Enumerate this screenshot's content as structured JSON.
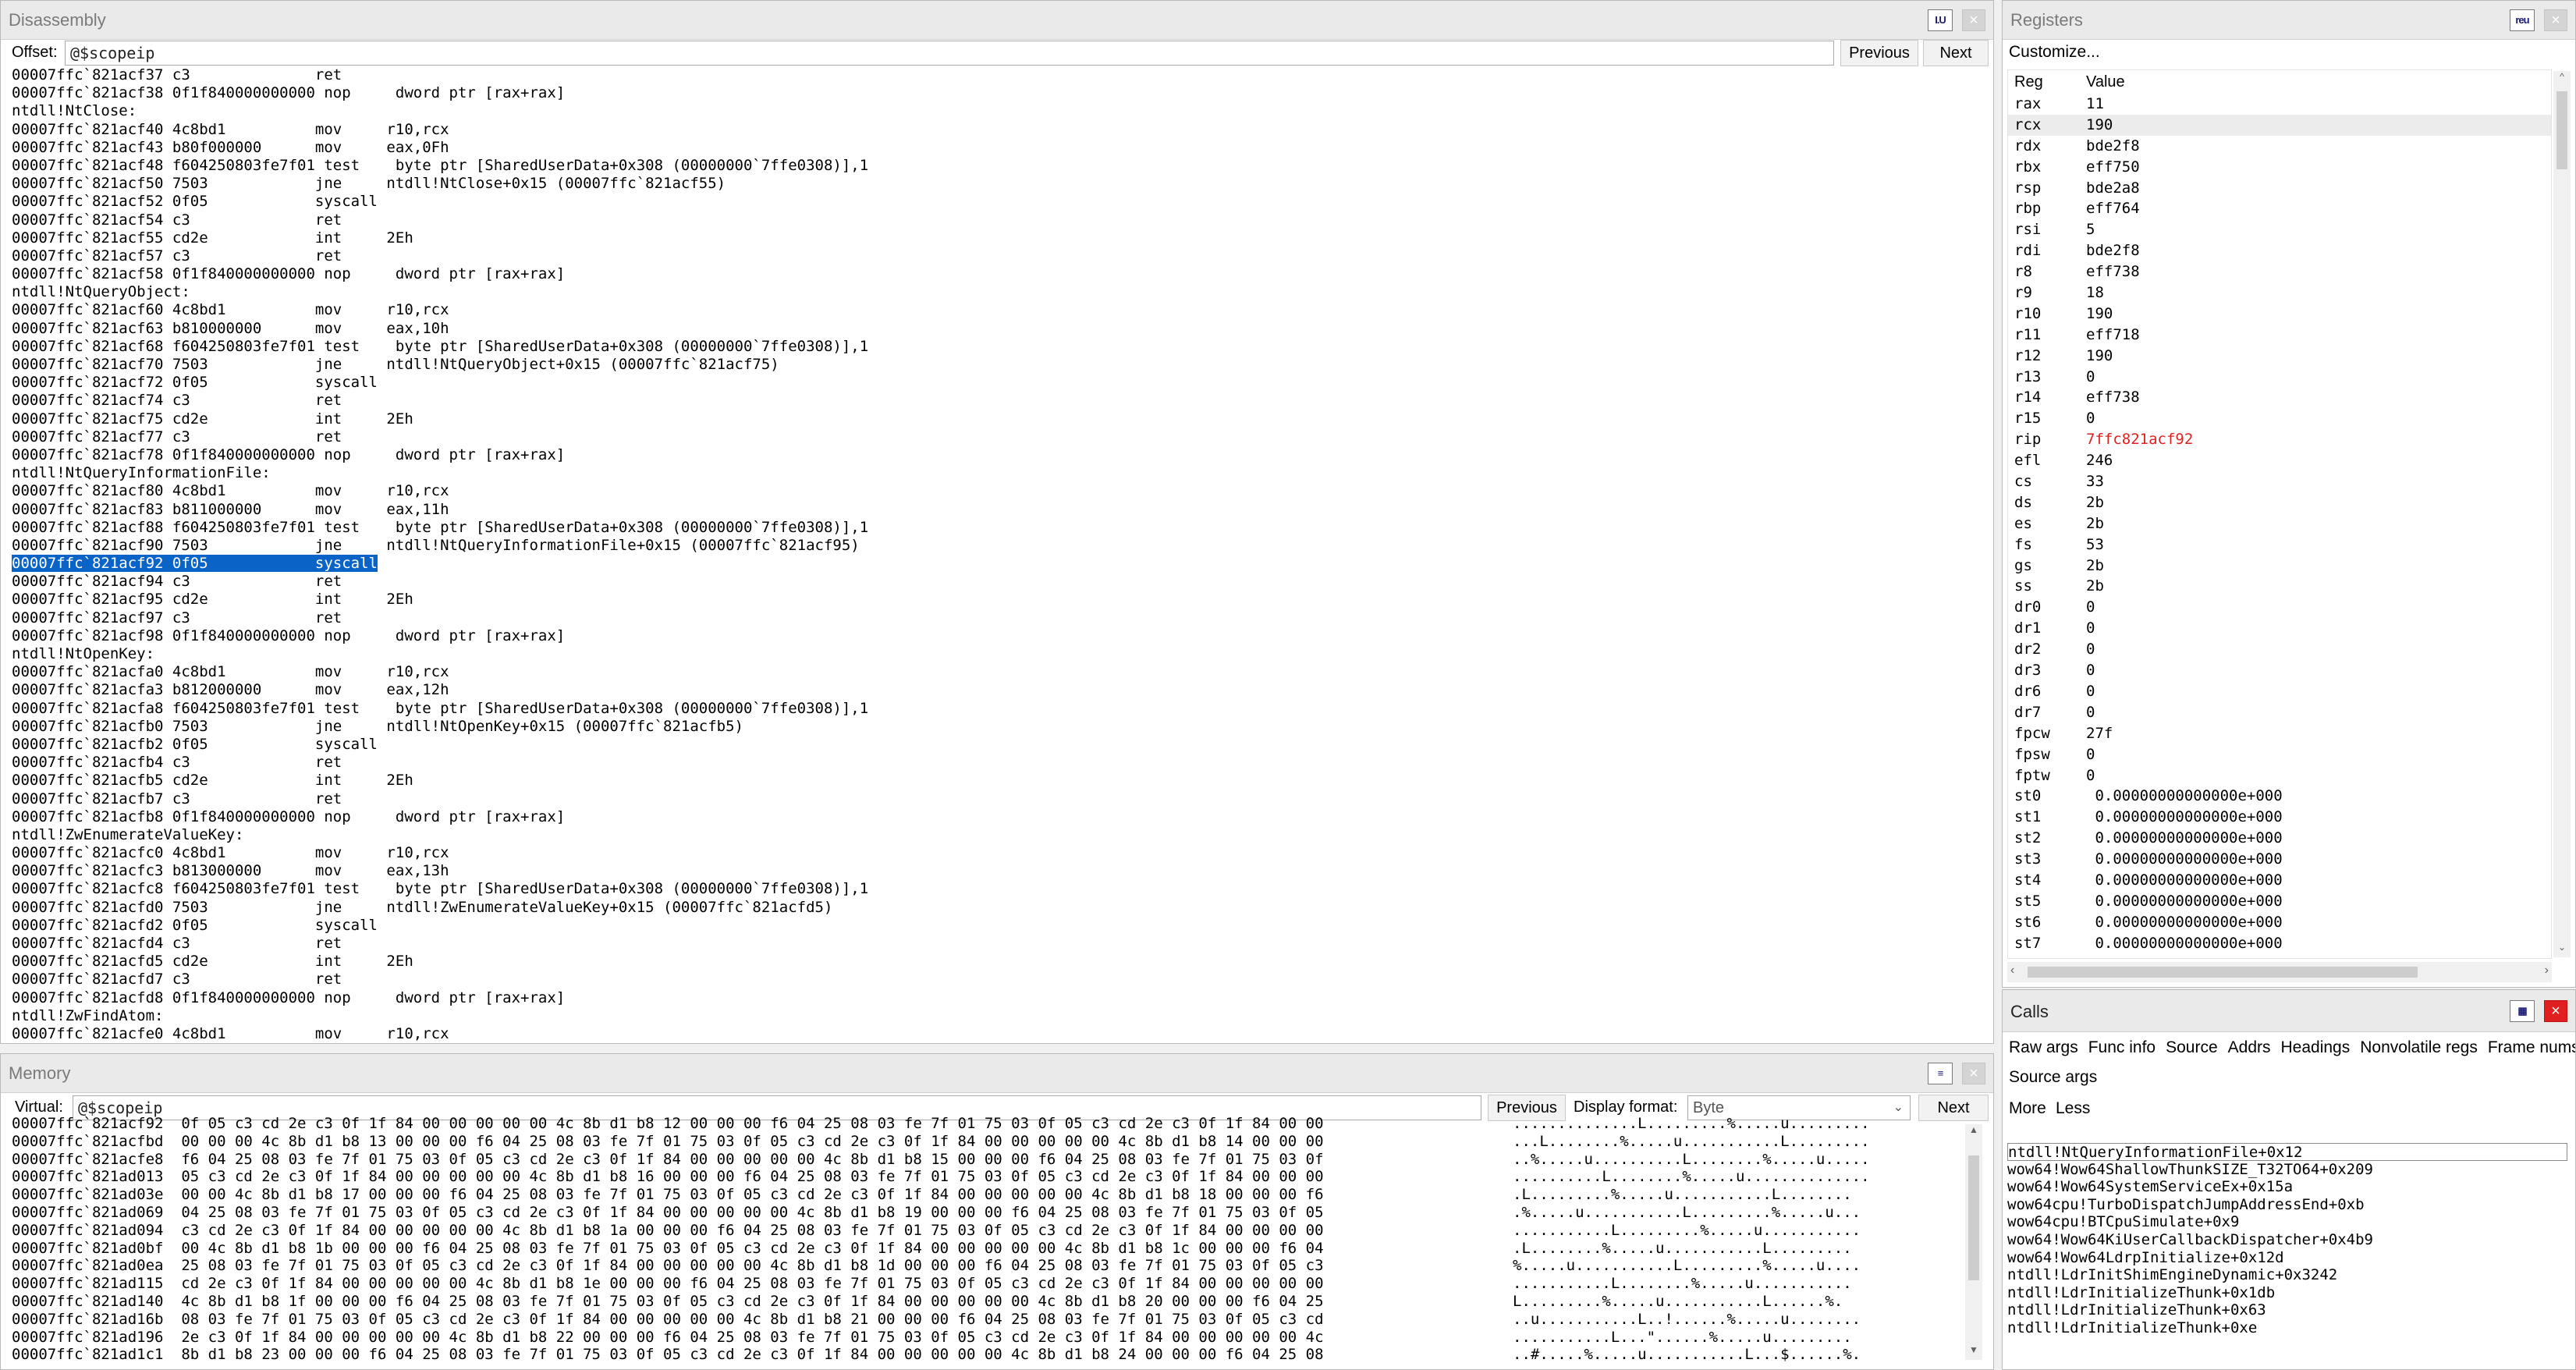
{
  "disassembly": {
    "title": "Disassembly",
    "offset_label": "Offset:",
    "offset_value": "@$scopeip",
    "prev_label": "Previous",
    "next_label": "Next",
    "lines": [
      "00007ffc`821acf37 c3              ret",
      "00007ffc`821acf38 0f1f840000000000 nop     dword ptr [rax+rax]",
      "ntdll!NtClose:",
      "00007ffc`821acf40 4c8bd1          mov     r10,rcx",
      "00007ffc`821acf43 b80f000000      mov     eax,0Fh",
      "00007ffc`821acf48 f604250803fe7f01 test    byte ptr [SharedUserData+0x308 (00000000`7ffe0308)],1",
      "00007ffc`821acf50 7503            jne     ntdll!NtClose+0x15 (00007ffc`821acf55)",
      "00007ffc`821acf52 0f05            syscall",
      "00007ffc`821acf54 c3              ret",
      "00007ffc`821acf55 cd2e            int     2Eh",
      "00007ffc`821acf57 c3              ret",
      "00007ffc`821acf58 0f1f840000000000 nop     dword ptr [rax+rax]",
      "ntdll!NtQueryObject:",
      "00007ffc`821acf60 4c8bd1          mov     r10,rcx",
      "00007ffc`821acf63 b810000000      mov     eax,10h",
      "00007ffc`821acf68 f604250803fe7f01 test    byte ptr [SharedUserData+0x308 (00000000`7ffe0308)],1",
      "00007ffc`821acf70 7503            jne     ntdll!NtQueryObject+0x15 (00007ffc`821acf75)",
      "00007ffc`821acf72 0f05            syscall",
      "00007ffc`821acf74 c3              ret",
      "00007ffc`821acf75 cd2e            int     2Eh",
      "00007ffc`821acf77 c3              ret",
      "00007ffc`821acf78 0f1f840000000000 nop     dword ptr [rax+rax]",
      "ntdll!NtQueryInformationFile:",
      "00007ffc`821acf80 4c8bd1          mov     r10,rcx",
      "00007ffc`821acf83 b811000000      mov     eax,11h",
      "00007ffc`821acf88 f604250803fe7f01 test    byte ptr [SharedUserData+0x308 (00000000`7ffe0308)],1",
      "00007ffc`821acf90 7503            jne     ntdll!NtQueryInformationFile+0x15 (00007ffc`821acf95)",
      "00007ffc`821acf92 0f05            syscall",
      "00007ffc`821acf94 c3              ret",
      "00007ffc`821acf95 cd2e            int     2Eh",
      "00007ffc`821acf97 c3              ret",
      "00007ffc`821acf98 0f1f840000000000 nop     dword ptr [rax+rax]",
      "ntdll!NtOpenKey:",
      "00007ffc`821acfa0 4c8bd1          mov     r10,rcx",
      "00007ffc`821acfa3 b812000000      mov     eax,12h",
      "00007ffc`821acfa8 f604250803fe7f01 test    byte ptr [SharedUserData+0x308 (00000000`7ffe0308)],1",
      "00007ffc`821acfb0 7503            jne     ntdll!NtOpenKey+0x15 (00007ffc`821acfb5)",
      "00007ffc`821acfb2 0f05            syscall",
      "00007ffc`821acfb4 c3              ret",
      "00007ffc`821acfb5 cd2e            int     2Eh",
      "00007ffc`821acfb7 c3              ret",
      "00007ffc`821acfb8 0f1f840000000000 nop     dword ptr [rax+rax]",
      "ntdll!ZwEnumerateValueKey:",
      "00007ffc`821acfc0 4c8bd1          mov     r10,rcx",
      "00007ffc`821acfc3 b813000000      mov     eax,13h",
      "00007ffc`821acfc8 f604250803fe7f01 test    byte ptr [SharedUserData+0x308 (00000000`7ffe0308)],1",
      "00007ffc`821acfd0 7503            jne     ntdll!ZwEnumerateValueKey+0x15 (00007ffc`821acfd5)",
      "00007ffc`821acfd2 0f05            syscall",
      "00007ffc`821acfd4 c3              ret",
      "00007ffc`821acfd5 cd2e            int     2Eh",
      "00007ffc`821acfd7 c3              ret",
      "00007ffc`821acfd8 0f1f840000000000 nop     dword ptr [rax+rax]",
      "ntdll!ZwFindAtom:",
      "00007ffc`821acfe0 4c8bd1          mov     r10,rcx"
    ],
    "highlighted_line_index": 27,
    "highlight_color": "#0a64c8"
  },
  "memory": {
    "title": "Memory",
    "virtual_label": "Virtual:",
    "virtual_value": "@$scopeip",
    "prev_label": "Previous",
    "display_format_label": "Display format:",
    "display_format_value": "Byte",
    "next_label": "Next",
    "lines": [
      "00007ffc`821acf92  0f 05 c3 cd 2e c3 0f 1f 84 00 00 00 00 00 4c 8b d1 b8 12 00 00 00 f6 04 25 08 03 fe 7f 01 75 03 0f 05 c3 cd 2e c3 0f 1f 84 00 00",
      "00007ffc`821acfbd  00 00 00 4c 8b d1 b8 13 00 00 00 f6 04 25 08 03 fe 7f 01 75 03 0f 05 c3 cd 2e c3 0f 1f 84 00 00 00 00 00 4c 8b d1 b8 14 00 00 00",
      "00007ffc`821acfe8  f6 04 25 08 03 fe 7f 01 75 03 0f 05 c3 cd 2e c3 0f 1f 84 00 00 00 00 00 4c 8b d1 b8 15 00 00 00 f6 04 25 08 03 fe 7f 01 75 03 0f",
      "00007ffc`821ad013  05 c3 cd 2e c3 0f 1f 84 00 00 00 00 00 4c 8b d1 b8 16 00 00 00 f6 04 25 08 03 fe 7f 01 75 03 0f 05 c3 cd 2e c3 0f 1f 84 00 00 00",
      "00007ffc`821ad03e  00 00 4c 8b d1 b8 17 00 00 00 f6 04 25 08 03 fe 7f 01 75 03 0f 05 c3 cd 2e c3 0f 1f 84 00 00 00 00 00 4c 8b d1 b8 18 00 00 00 f6",
      "00007ffc`821ad069  04 25 08 03 fe 7f 01 75 03 0f 05 c3 cd 2e c3 0f 1f 84 00 00 00 00 00 4c 8b d1 b8 19 00 00 00 f6 04 25 08 03 fe 7f 01 75 03 0f 05",
      "00007ffc`821ad094  c3 cd 2e c3 0f 1f 84 00 00 00 00 00 4c 8b d1 b8 1a 00 00 00 f6 04 25 08 03 fe 7f 01 75 03 0f 05 c3 cd 2e c3 0f 1f 84 00 00 00 00",
      "00007ffc`821ad0bf  00 4c 8b d1 b8 1b 00 00 00 f6 04 25 08 03 fe 7f 01 75 03 0f 05 c3 cd 2e c3 0f 1f 84 00 00 00 00 00 4c 8b d1 b8 1c 00 00 00 f6 04",
      "00007ffc`821ad0ea  25 08 03 fe 7f 01 75 03 0f 05 c3 cd 2e c3 0f 1f 84 00 00 00 00 00 4c 8b d1 b8 1d 00 00 00 f6 04 25 08 03 fe 7f 01 75 03 0f 05 c3",
      "00007ffc`821ad115  cd 2e c3 0f 1f 84 00 00 00 00 00 4c 8b d1 b8 1e 00 00 00 f6 04 25 08 03 fe 7f 01 75 03 0f 05 c3 cd 2e c3 0f 1f 84 00 00 00 00 00",
      "00007ffc`821ad140  4c 8b d1 b8 1f 00 00 00 f6 04 25 08 03 fe 7f 01 75 03 0f 05 c3 cd 2e c3 0f 1f 84 00 00 00 00 00 4c 8b d1 b8 20 00 00 00 f6 04 25",
      "00007ffc`821ad16b  08 03 fe 7f 01 75 03 0f 05 c3 cd 2e c3 0f 1f 84 00 00 00 00 00 4c 8b d1 b8 21 00 00 00 f6 04 25 08 03 fe 7f 01 75 03 0f 05 c3 cd",
      "00007ffc`821ad196  2e c3 0f 1f 84 00 00 00 00 00 4c 8b d1 b8 22 00 00 00 f6 04 25 08 03 fe 7f 01 75 03 0f 05 c3 cd 2e c3 0f 1f 84 00 00 00 00 00 4c",
      "00007ffc`821ad1c1  8b d1 b8 23 00 00 00 f6 04 25 08 03 fe 7f 01 75 03 0f 05 c3 cd 2e c3 0f 1f 84 00 00 00 00 00 4c 8b d1 b8 24 00 00 00 f6 04 25 08"
    ],
    "ascii": [
      "..............L.........%.....u.........",
      "...L........%.....u...........L.........",
      "..%.....u..........L........%.....u.....",
      "..........L........%.....u..............",
      ".L.........%.....u...........L........",
      ".%.....u...........L.........%.....u...",
      "...........L.........%.....u...........",
      ".L........%.....u...........L.........",
      "%.....u...........L.........%.....u....",
      "...........L........%.....u...........",
      "L.........%.....u...........L......%.",
      "..u...........L..!......%.....u........",
      "...........L...\"......%.....u.........",
      "..#.....%.....u...........L...$......%."
    ]
  },
  "registers": {
    "title": "Registers",
    "customize_label": "Customize...",
    "col_reg": "Reg",
    "col_value": "Value",
    "changed_color": "#e02020",
    "rows": [
      {
        "reg": "rax",
        "value": "11",
        "changed": false
      },
      {
        "reg": "rcx",
        "value": "190",
        "changed": false
      },
      {
        "reg": "rdx",
        "value": "bde2f8",
        "changed": false
      },
      {
        "reg": "rbx",
        "value": "eff750",
        "changed": false
      },
      {
        "reg": "rsp",
        "value": "bde2a8",
        "changed": false
      },
      {
        "reg": "rbp",
        "value": "eff764",
        "changed": false
      },
      {
        "reg": "rsi",
        "value": "5",
        "changed": false
      },
      {
        "reg": "rdi",
        "value": "bde2f8",
        "changed": false
      },
      {
        "reg": "r8",
        "value": "eff738",
        "changed": false
      },
      {
        "reg": "r9",
        "value": "18",
        "changed": false
      },
      {
        "reg": "r10",
        "value": "190",
        "changed": false
      },
      {
        "reg": "r11",
        "value": "eff718",
        "changed": false
      },
      {
        "reg": "r12",
        "value": "190",
        "changed": false
      },
      {
        "reg": "r13",
        "value": "0",
        "changed": false
      },
      {
        "reg": "r14",
        "value": "eff738",
        "changed": false
      },
      {
        "reg": "r15",
        "value": "0",
        "changed": false
      },
      {
        "reg": "rip",
        "value": "7ffc821acf92",
        "changed": true
      },
      {
        "reg": "efl",
        "value": "246",
        "changed": false
      },
      {
        "reg": "cs",
        "value": "33",
        "changed": false
      },
      {
        "reg": "ds",
        "value": "2b",
        "changed": false
      },
      {
        "reg": "es",
        "value": "2b",
        "changed": false
      },
      {
        "reg": "fs",
        "value": "53",
        "changed": false
      },
      {
        "reg": "gs",
        "value": "2b",
        "changed": false
      },
      {
        "reg": "ss",
        "value": "2b",
        "changed": false
      },
      {
        "reg": "dr0",
        "value": "0",
        "changed": false
      },
      {
        "reg": "dr1",
        "value": "0",
        "changed": false
      },
      {
        "reg": "dr2",
        "value": "0",
        "changed": false
      },
      {
        "reg": "dr3",
        "value": "0",
        "changed": false
      },
      {
        "reg": "dr6",
        "value": "0",
        "changed": false
      },
      {
        "reg": "dr7",
        "value": "0",
        "changed": false
      },
      {
        "reg": "fpcw",
        "value": "27f",
        "changed": false
      },
      {
        "reg": "fpsw",
        "value": "0",
        "changed": false
      },
      {
        "reg": "fptw",
        "value": "0",
        "changed": false
      },
      {
        "reg": "st0",
        "value": " 0.00000000000000e+000",
        "changed": false
      },
      {
        "reg": "st1",
        "value": " 0.00000000000000e+000",
        "changed": false
      },
      {
        "reg": "st2",
        "value": " 0.00000000000000e+000",
        "changed": false
      },
      {
        "reg": "st3",
        "value": " 0.00000000000000e+000",
        "changed": false
      },
      {
        "reg": "st4",
        "value": " 0.00000000000000e+000",
        "changed": false
      },
      {
        "reg": "st5",
        "value": " 0.00000000000000e+000",
        "changed": false
      },
      {
        "reg": "st6",
        "value": " 0.00000000000000e+000",
        "changed": false
      },
      {
        "reg": "st7",
        "value": " 0.00000000000000e+000",
        "changed": false
      }
    ]
  },
  "calls": {
    "title": "Calls",
    "options": [
      "Raw args",
      "Func info",
      "Source",
      "Addrs",
      "Headings",
      "Nonvolatile regs",
      "Frame nums"
    ],
    "source_args": "Source args",
    "more": "More",
    "less": "Less",
    "frames": [
      "ntdll!NtQueryInformationFile+0x12",
      "wow64!Wow64ShallowThunkSIZE_T32TO64+0x209",
      "wow64!Wow64SystemServiceEx+0x15a",
      "wow64cpu!TurboDispatchJumpAddressEnd+0xb",
      "wow64cpu!BTCpuSimulate+0x9",
      "wow64!Wow64KiUserCallbackDispatcher+0x4b9",
      "wow64!Wow64LdrpInitialize+0x12d",
      "ntdll!LdrInitShimEngineDynamic+0x3242",
      "ntdll!LdrInitializeThunk+0x1db",
      "ntdll!LdrInitializeThunk+0x63",
      "ntdll!LdrInitializeThunk+0xe"
    ]
  }
}
